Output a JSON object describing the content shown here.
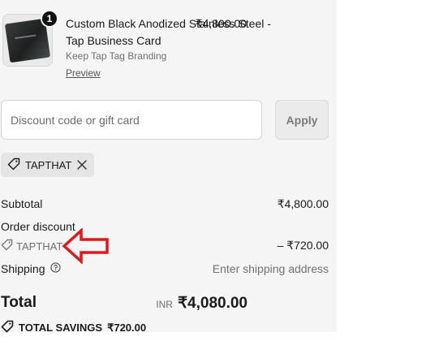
{
  "line_item": {
    "quantity": "1",
    "name": "Custom Black Anodized Stainless Steel - Tap Business Card",
    "price": "₹4,800.00",
    "variant": "Keep Tap Tag Branding",
    "preview_label": "Preview"
  },
  "discount": {
    "placeholder": "Discount code or gift card",
    "apply_label": "Apply",
    "applied_code": "TAPTHAT"
  },
  "summary": {
    "subtotal_label": "Subtotal",
    "subtotal_value": "₹4,800.00",
    "order_discount_label": "Order discount",
    "discount_code": "TAPTHAT",
    "discount_value": "– ₹720.00",
    "shipping_label": "Shipping",
    "shipping_value": "Enter shipping address",
    "total_label": "Total",
    "total_currency": "INR",
    "total_value": "₹4,080.00",
    "savings_label": "TOTAL SAVINGS",
    "savings_value": "₹720.00"
  },
  "colors": {
    "panel_bg": "#f5f5f5",
    "annotation_arrow": "#e0181b"
  },
  "icons": [
    "tag-icon",
    "close-icon",
    "help-circle-icon",
    "annotation-arrow-icon"
  ]
}
